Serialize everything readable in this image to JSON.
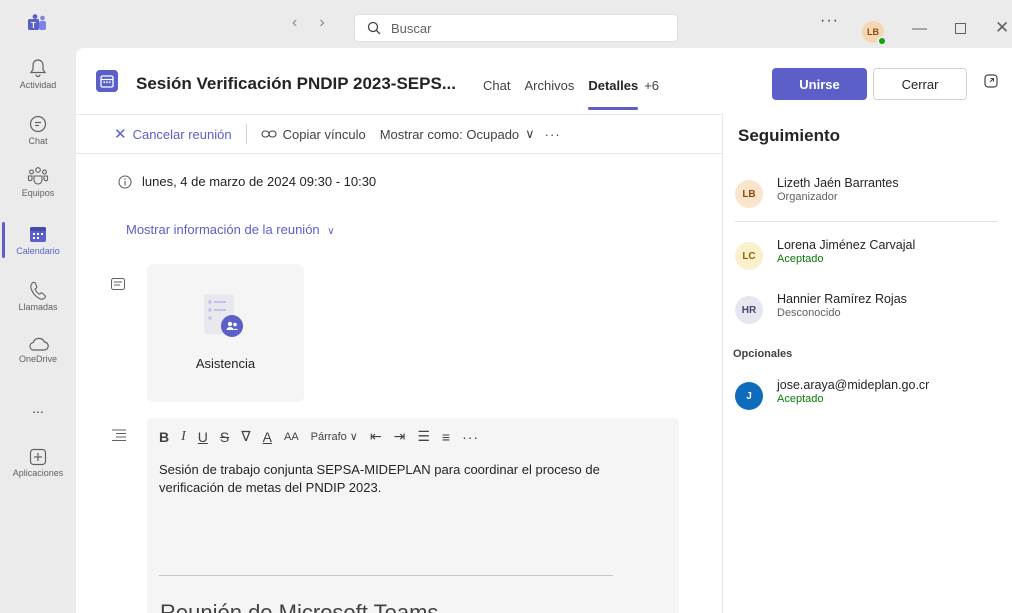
{
  "titlebar": {
    "search_placeholder": "Buscar",
    "more": "···",
    "user_initials": "LB"
  },
  "rail": {
    "items": [
      {
        "label": "Actividad",
        "icon": "bell-icon"
      },
      {
        "label": "Chat",
        "icon": "chat-icon"
      },
      {
        "label": "Equipos",
        "icon": "teams-icon"
      },
      {
        "label": "Calendario",
        "icon": "calendar-icon"
      },
      {
        "label": "Llamadas",
        "icon": "phone-icon"
      },
      {
        "label": "OneDrive",
        "icon": "cloud-icon"
      },
      {
        "label": "...",
        "icon": "more-icon"
      },
      {
        "label": "Aplicaciones",
        "icon": "plus-square-icon"
      }
    ]
  },
  "header": {
    "title": "Sesión Verificación PNDIP 2023-SEPS...",
    "tabs": [
      "Chat",
      "Archivos",
      "Detalles",
      "+6"
    ],
    "active_tab": "Detalles",
    "join_label": "Unirse",
    "close_label": "Cerrar"
  },
  "toolbar": {
    "cancel_label": "Cancelar reunión",
    "copy_label": "Copiar vínculo",
    "show_as_label": "Mostrar como: Ocupado",
    "more": "···"
  },
  "meeting": {
    "datetime": "lunes, 4 de marzo de 2024 09:30 - 10:30",
    "info_link": "Mostrar información de la reunión",
    "attendance_label": "Asistencia"
  },
  "editor": {
    "paragraph_style": "Párrafo",
    "body_text": "Sesión de trabajo conjunta SEPSA-MIDEPLAN para coordinar el proceso de verificación de  metas  del PNDIP 2023.",
    "clipped_heading": "Reunión de Microsoft Teams"
  },
  "tracking": {
    "title": "Seguimiento",
    "organizer": {
      "initials": "LB",
      "name": "Lizeth Jaén Barrantes",
      "status": "Organizador"
    },
    "attendees": [
      {
        "initials": "LC",
        "name": "Lorena Jiménez Carvajal",
        "status": "Aceptado"
      },
      {
        "initials": "HR",
        "name": "Hannier Ramírez Rojas",
        "status": "Desconocido"
      }
    ],
    "optional_heading": "Opcionales",
    "optional": [
      {
        "initials": "J",
        "name": "jose.araya@mideplan.go.cr",
        "status": "Aceptado"
      }
    ]
  },
  "colors": {
    "accent": "#5b5fc7",
    "accepted": "#0e7a0b",
    "presence": "#13a10e"
  }
}
